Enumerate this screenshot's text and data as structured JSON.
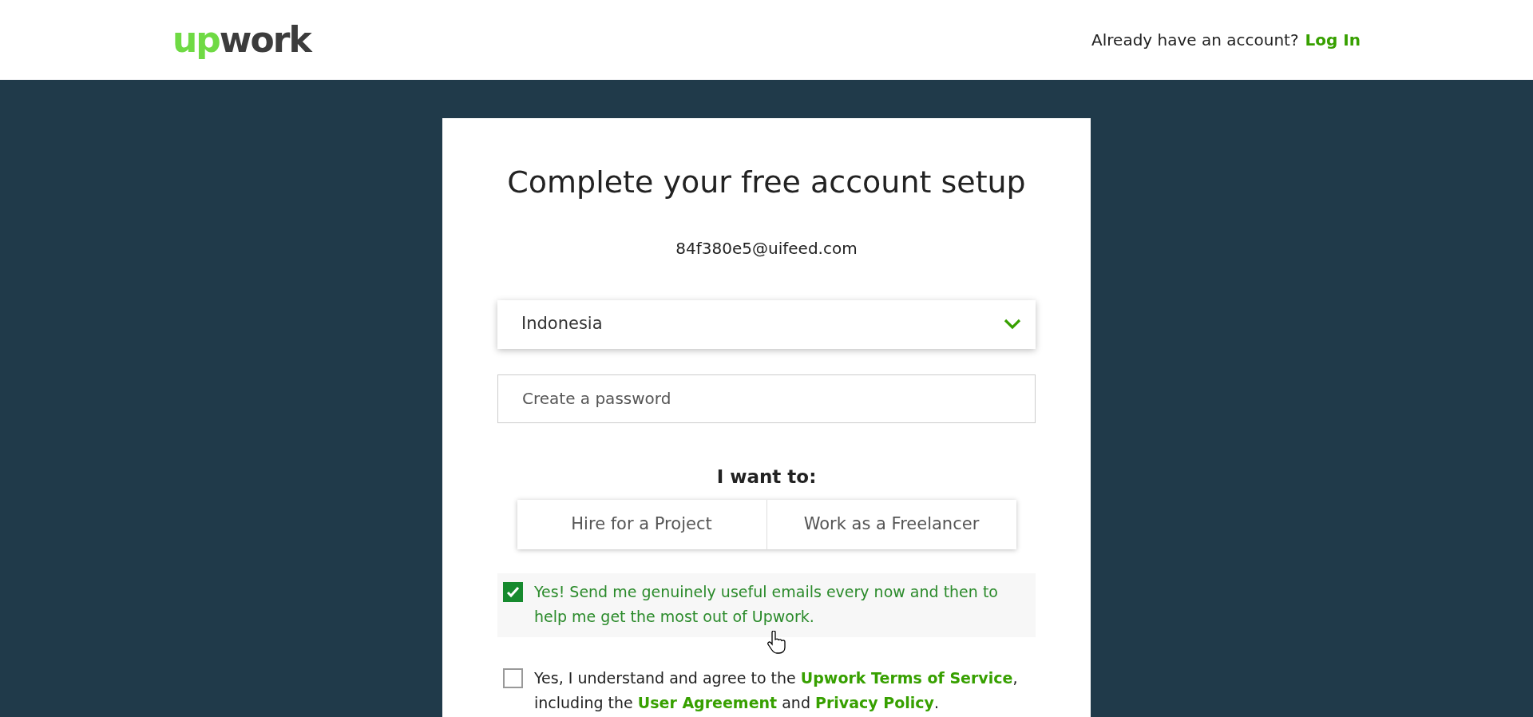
{
  "header": {
    "logo": {
      "part_1": "up",
      "part_2": "work"
    },
    "prompt": "Already have an account?",
    "login_link": "Log In"
  },
  "form": {
    "title": "Complete your free account setup",
    "email": "84f380e5@uifeed.com",
    "country": {
      "value": "Indonesia"
    },
    "password": {
      "placeholder": "Create a password"
    },
    "role_label": "I want to:",
    "roles": [
      {
        "label": "Hire for a Project",
        "selected": false
      },
      {
        "label": "Work as a Freelancer",
        "selected": false
      }
    ],
    "consents": [
      {
        "checked": true,
        "parts": [
          {
            "kind": "text",
            "text": "Yes! Send me genuinely useful emails every now and then to help me get the most out of Upwork."
          }
        ]
      },
      {
        "checked": false,
        "parts": [
          {
            "kind": "text",
            "text": "Yes, I understand and agree to the "
          },
          {
            "kind": "link",
            "text": "Upwork Terms of Service"
          },
          {
            "kind": "text",
            "text": ", including the "
          },
          {
            "kind": "link",
            "text": "User Agreement"
          },
          {
            "kind": "text",
            "text": " and "
          },
          {
            "kind": "link",
            "text": "Privacy Policy"
          },
          {
            "kind": "text",
            "text": "."
          }
        ]
      }
    ]
  }
}
